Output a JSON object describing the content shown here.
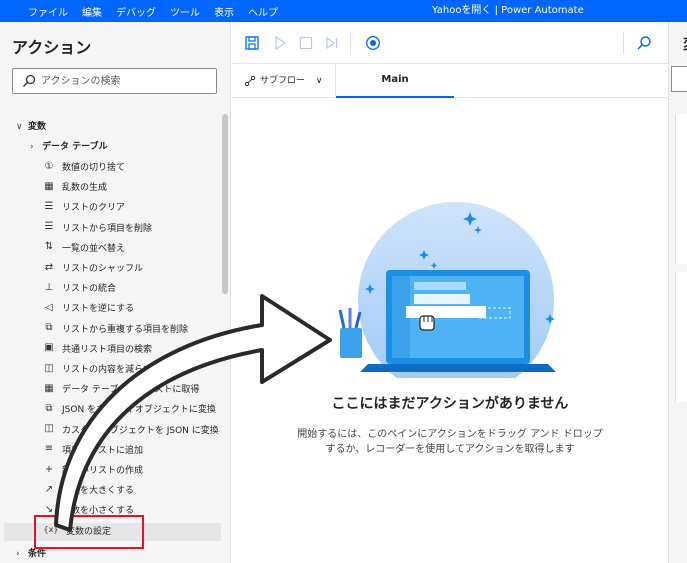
{
  "titlebar": {
    "menu": [
      "ファイル",
      "編集",
      "デバッグ",
      "ツール",
      "表示",
      "ヘルプ"
    ],
    "window_title": "Yahooを開く | Power Automate"
  },
  "actions_pane": {
    "title": "アクション",
    "search_placeholder": "アクションの検索",
    "category": "変数",
    "subcategory": "データ テーブル",
    "items": [
      {
        "label": "数値の切り捨て",
        "icon": "number-circle-icon"
      },
      {
        "label": "乱数の生成",
        "icon": "random-icon"
      },
      {
        "label": "リストのクリア",
        "icon": "list-clear-icon"
      },
      {
        "label": "リストから項目を削除",
        "icon": "list-remove-icon"
      },
      {
        "label": "一覧の並べ替え",
        "icon": "sort-icon"
      },
      {
        "label": "リストのシャッフル",
        "icon": "shuffle-icon"
      },
      {
        "label": "リストの統合",
        "icon": "merge-icon"
      },
      {
        "label": "リストを逆にする",
        "icon": "reverse-icon"
      },
      {
        "label": "リストから重複する項目を削除",
        "icon": "dedupe-icon"
      },
      {
        "label": "共通リスト項目の検索",
        "icon": "common-items-icon"
      },
      {
        "label": "リストの内容を減らす",
        "icon": "subtract-list-icon"
      },
      {
        "label": "データ テーブル列をリストに取得",
        "icon": "table-column-icon"
      },
      {
        "label": "JSON をカスタム オブジェクトに変換",
        "icon": "json-convert-icon"
      },
      {
        "label": "カスタム オブジェクトを JSON に変換",
        "icon": "object-convert-icon"
      },
      {
        "label": "項目をリストに追加",
        "icon": "list-add-icon"
      },
      {
        "label": "新しいリストの作成",
        "icon": "plus-icon"
      },
      {
        "label": "変数を大きくする",
        "icon": "increase-icon"
      },
      {
        "label": "変数を小さくする",
        "icon": "decrease-icon"
      },
      {
        "label": "変数の設定",
        "icon": "variable-icon"
      }
    ],
    "next_category": "条件"
  },
  "tabs": {
    "subflow": "サブフロー",
    "main": "Main"
  },
  "empty_state": {
    "title": "ここにはまだアクションがありません",
    "desc_line1": "開始するには、このペインにアクションをドラッグ アンド ドロップ",
    "desc_line2": "するか、レコーダーを使用してアクションを取得します"
  },
  "right_pane": {
    "title": "変"
  },
  "colors": {
    "accent": "#0066ff",
    "highlight": "#e2142d"
  }
}
